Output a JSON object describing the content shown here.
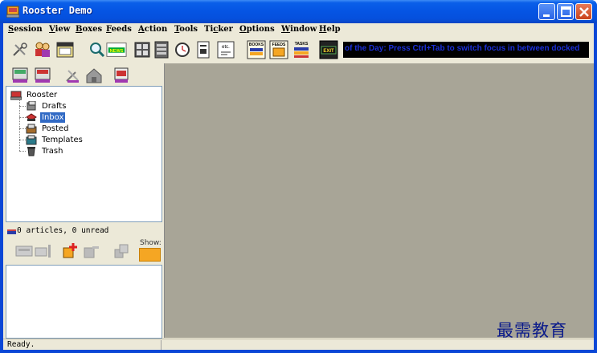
{
  "window": {
    "title": "Rooster Demo",
    "buttons": [
      "minimize-button",
      "maximize-button",
      "close-button"
    ]
  },
  "menu": {
    "items": [
      {
        "label": "Session",
        "mnemonic": "S"
      },
      {
        "label": "View",
        "mnemonic": "V"
      },
      {
        "label": "Boxes",
        "mnemonic": "B"
      },
      {
        "label": "Feeds",
        "mnemonic": "F"
      },
      {
        "label": "Action",
        "mnemonic": "A"
      },
      {
        "label": "Tools",
        "mnemonic": "T"
      },
      {
        "label": "Ticker",
        "mnemonic": "c"
      },
      {
        "label": "Options",
        "mnemonic": "O"
      },
      {
        "label": "Window",
        "mnemonic": "W"
      },
      {
        "label": "Help",
        "mnemonic": "H"
      }
    ]
  },
  "toolbar": {
    "icons": [
      "tools-icon",
      "users-icon",
      "calendar-icon",
      "search-icon",
      "news-icon",
      "grid-icon",
      "document-grid-icon",
      "clock-icon",
      "notes-icon",
      "etc-icon",
      "books-icon",
      "feeds-icon",
      "tasks-icon",
      "exit-icon"
    ],
    "labels": {
      "news": "NEWS",
      "etc": "etc.",
      "books": "BOOKS",
      "feeds": "FEEDS",
      "tasks": "TASKS",
      "exit": "EXIT"
    }
  },
  "ticker": {
    "text": "of the Day: Press Ctrl+Tab to switch focus in between docked"
  },
  "tree": {
    "root": "Rooster",
    "folders": [
      {
        "label": "Drafts",
        "icon": "drafts-icon",
        "selected": false
      },
      {
        "label": "Inbox",
        "icon": "inbox-icon",
        "selected": true
      },
      {
        "label": "Posted",
        "icon": "posted-icon",
        "selected": false
      },
      {
        "label": "Templates",
        "icon": "templates-icon",
        "selected": false
      },
      {
        "label": "Trash",
        "icon": "trash-icon",
        "selected": false
      }
    ]
  },
  "articles": {
    "summary": "0 articles, 0 unread"
  },
  "show": {
    "label": "Show:",
    "color": "#f5a623"
  },
  "status": {
    "text": "Ready."
  },
  "watermark": {
    "text": "最需教育"
  },
  "colors": {
    "titlebar": "#0554e3",
    "window_face": "#ece9d8",
    "content_area": "#a8a597",
    "selection": "#316ac5",
    "ticker_bg": "#000000",
    "ticker_text": "#1a2fd8"
  }
}
